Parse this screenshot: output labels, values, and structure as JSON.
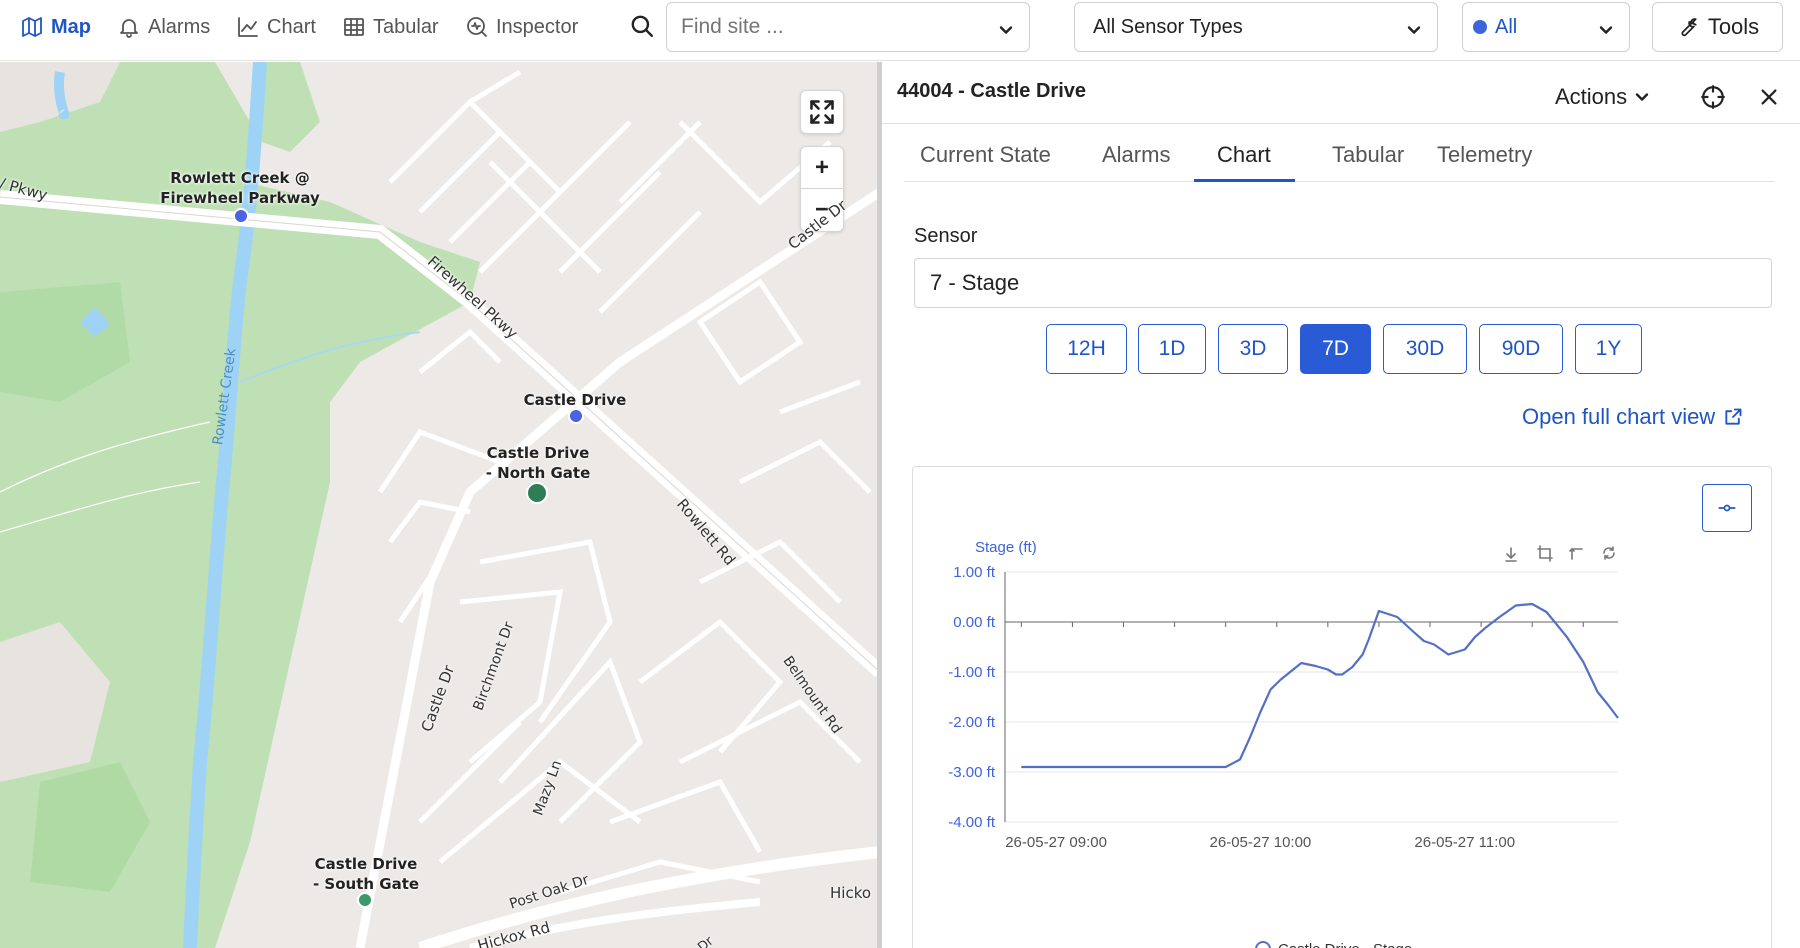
{
  "nav": {
    "items": [
      {
        "key": "map",
        "label": "Map",
        "icon": "map-icon",
        "active": true
      },
      {
        "key": "alarms",
        "label": "Alarms",
        "icon": "bell-icon",
        "active": false
      },
      {
        "key": "chart",
        "label": "Chart",
        "icon": "line-chart-icon",
        "active": false
      },
      {
        "key": "tabular",
        "label": "Tabular",
        "icon": "table-icon",
        "active": false
      },
      {
        "key": "inspector",
        "label": "Inspector",
        "icon": "inspector-icon",
        "active": false
      }
    ]
  },
  "search": {
    "placeholder": "Find site ...",
    "value": ""
  },
  "filters": {
    "sensor_types": "All Sensor Types",
    "status": "All",
    "status_color": "#3d63dd"
  },
  "tools_label": "Tools",
  "map": {
    "sites": [
      {
        "name": "Rowlett Creek @\nFirewheel Parkway",
        "color": "#4a63e0"
      },
      {
        "name": "Castle Drive",
        "color": "#4a63e0"
      },
      {
        "name": "Castle Drive\n- North Gate",
        "color": "#2e7d55"
      },
      {
        "name": "Castle Drive\n- South Gate",
        "color": "#3a9a6a"
      }
    ],
    "roads": [
      "/ Pkwy",
      "Firewheel Pkwy",
      "Rowlett Creek",
      "Castle Dr",
      "Castle Dr",
      "Birchmont Dr",
      "Mazy Ln",
      "Rowlett Rd",
      "Belmount Rd",
      "Post Oak Dr",
      "Hickox Rd",
      "Hicko",
      "Dr"
    ],
    "controls": {
      "zoom_in": "+",
      "zoom_out": "−"
    }
  },
  "panel": {
    "title": "44004 - Castle Drive",
    "actions_label": "Actions",
    "tabs": [
      "Current State",
      "Alarms",
      "Chart",
      "Tabular",
      "Telemetry"
    ],
    "active_tab": "Chart",
    "sensor_label": "Sensor",
    "sensor_value": "7 - Stage",
    "ranges": [
      "12H",
      "1D",
      "3D",
      "7D",
      "30D",
      "90D",
      "1Y"
    ],
    "active_range": "7D",
    "full_chart_link": "Open full chart view"
  },
  "chart_data": {
    "type": "line",
    "ylabel": "Stage (ft)",
    "ylim": [
      -4,
      1
    ],
    "yticks": [
      "1.00 ft",
      "0.00 ft",
      "-1.00 ft",
      "-2.00 ft",
      "-3.00 ft",
      "-4.00 ft"
    ],
    "xticks": [
      "26-05-27 09:00",
      "26-05-27 10:00",
      "26-05-27 11:00"
    ],
    "xtick_hours": [
      9,
      10,
      11
    ],
    "grid": true,
    "legend_position": "bottom",
    "series": [
      {
        "name": "Castle Drive - Stage",
        "color": "#5470c6",
        "points": [
          [
            8.83,
            -2.9
          ],
          [
            9.0,
            -2.9
          ],
          [
            9.25,
            -2.9
          ],
          [
            9.5,
            -2.9
          ],
          [
            9.75,
            -2.9
          ],
          [
            9.83,
            -2.9
          ],
          [
            9.9,
            -2.75
          ],
          [
            9.95,
            -2.3
          ],
          [
            10.0,
            -1.8
          ],
          [
            10.05,
            -1.35
          ],
          [
            10.1,
            -1.15
          ],
          [
            10.2,
            -0.82
          ],
          [
            10.27,
            -0.88
          ],
          [
            10.33,
            -0.95
          ],
          [
            10.37,
            -1.05
          ],
          [
            10.4,
            -1.05
          ],
          [
            10.45,
            -0.9
          ],
          [
            10.5,
            -0.65
          ],
          [
            10.53,
            -0.35
          ],
          [
            10.58,
            0.22
          ],
          [
            10.67,
            0.1
          ],
          [
            10.75,
            -0.2
          ],
          [
            10.8,
            -0.38
          ],
          [
            10.85,
            -0.45
          ],
          [
            10.92,
            -0.65
          ],
          [
            11.0,
            -0.55
          ],
          [
            11.05,
            -0.3
          ],
          [
            11.1,
            -0.12
          ],
          [
            11.17,
            0.1
          ],
          [
            11.25,
            0.33
          ],
          [
            11.33,
            0.36
          ],
          [
            11.4,
            0.2
          ],
          [
            11.5,
            -0.3
          ],
          [
            11.58,
            -0.8
          ],
          [
            11.65,
            -1.4
          ],
          [
            11.7,
            -1.65
          ],
          [
            11.75,
            -1.92
          ]
        ]
      }
    ]
  }
}
